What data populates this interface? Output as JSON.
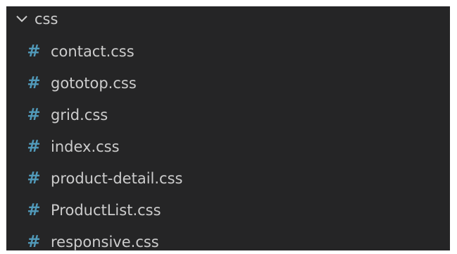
{
  "explorer": {
    "folder": {
      "name": "css",
      "expanded": true,
      "icon": "chevron-down-icon"
    },
    "files": [
      {
        "name": "contact.css",
        "icon": "hash-icon",
        "icon_glyph": "#"
      },
      {
        "name": "gototop.css",
        "icon": "hash-icon",
        "icon_glyph": "#"
      },
      {
        "name": "grid.css",
        "icon": "hash-icon",
        "icon_glyph": "#"
      },
      {
        "name": "index.css",
        "icon": "hash-icon",
        "icon_glyph": "#"
      },
      {
        "name": "product-detail.css",
        "icon": "hash-icon",
        "icon_glyph": "#"
      },
      {
        "name": "ProductList.css",
        "icon": "hash-icon",
        "icon_glyph": "#"
      },
      {
        "name": "responsive.css",
        "icon": "hash-icon",
        "icon_glyph": "#"
      }
    ]
  },
  "colors": {
    "background": "#252526",
    "text": "#cccccc",
    "css_icon": "#519aba"
  }
}
